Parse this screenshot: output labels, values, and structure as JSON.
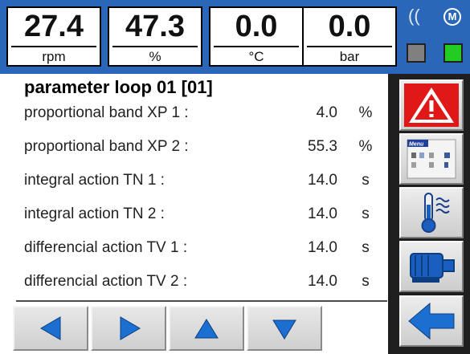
{
  "gauges": [
    {
      "value": "27.4",
      "unit": "rpm"
    },
    {
      "value": "47.3",
      "unit": "%"
    },
    {
      "value": "0.0",
      "unit": "°C"
    },
    {
      "value": "0.0",
      "unit": "bar"
    }
  ],
  "status": {
    "glyph": "((",
    "motor_letter": "M",
    "led_left_color": "#808080",
    "led_right_color": "#22cc22"
  },
  "panel": {
    "title": "parameter loop 01  [01]",
    "rows": [
      {
        "label": "proportional band XP 1 :",
        "value": "4.0",
        "unit": "%"
      },
      {
        "label": "proportional band XP 2 :",
        "value": "55.3",
        "unit": "%"
      },
      {
        "label": "integral action TN 1 :",
        "value": "14.0",
        "unit": "s"
      },
      {
        "label": "integral action TN 2 :",
        "value": "14.0",
        "unit": "s"
      },
      {
        "label": "differencial action TV 1 :",
        "value": "14.0",
        "unit": "s"
      },
      {
        "label": "differencial action TV 2 :",
        "value": "14.0",
        "unit": "s"
      }
    ]
  },
  "tools": {
    "menu_label": "Menu"
  },
  "icons": {
    "nav": [
      "arrow-left-icon",
      "arrow-right-icon",
      "arrow-up-icon",
      "arrow-down-icon"
    ],
    "tools": [
      "warning-icon",
      "menu-icon",
      "temperature-icon",
      "motor-icon",
      "back-arrow-icon"
    ]
  },
  "colors": {
    "topbar": "#2a67b8",
    "nav_arrow": "#1a6fd0",
    "warning": "#e01818",
    "back_arrow": "#1a6fd0"
  }
}
